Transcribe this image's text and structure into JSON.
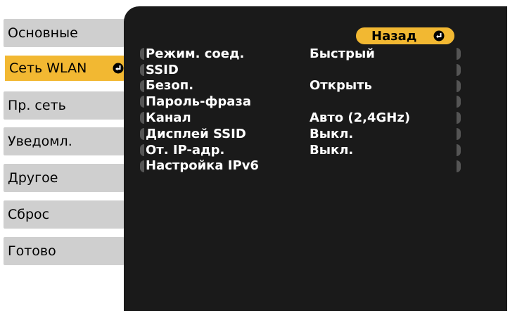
{
  "sidebar": {
    "items": [
      {
        "label": "Основные"
      },
      {
        "label": "Сеть WLAN"
      },
      {
        "label": "Пр. сеть"
      },
      {
        "label": "Уведомл."
      },
      {
        "label": "Другое"
      },
      {
        "label": "Сброс"
      },
      {
        "label": "Готово"
      }
    ],
    "selected_index": 1
  },
  "panel": {
    "back_label": "Назад",
    "rows": [
      {
        "label": "Режим. соед.",
        "value": "Быстрый"
      },
      {
        "label": "SSID",
        "value": ""
      },
      {
        "label": "Безоп.",
        "value": "Открыть"
      },
      {
        "label": "Пароль-фраза",
        "value": ""
      },
      {
        "label": "Канал",
        "value": "Авто (2,4GHz)"
      },
      {
        "label": "Дисплей SSID",
        "value": "Выкл."
      },
      {
        "label": "От. IP-адр.",
        "value": "Выкл."
      },
      {
        "label": "Настройка IPv6",
        "value": ""
      }
    ]
  },
  "colors": {
    "accent": "#f2b832",
    "panel_bg": "#1a1a1a",
    "sidebar_bg": "#cfcfcf"
  },
  "icons": {
    "enter": "enter-icon"
  }
}
